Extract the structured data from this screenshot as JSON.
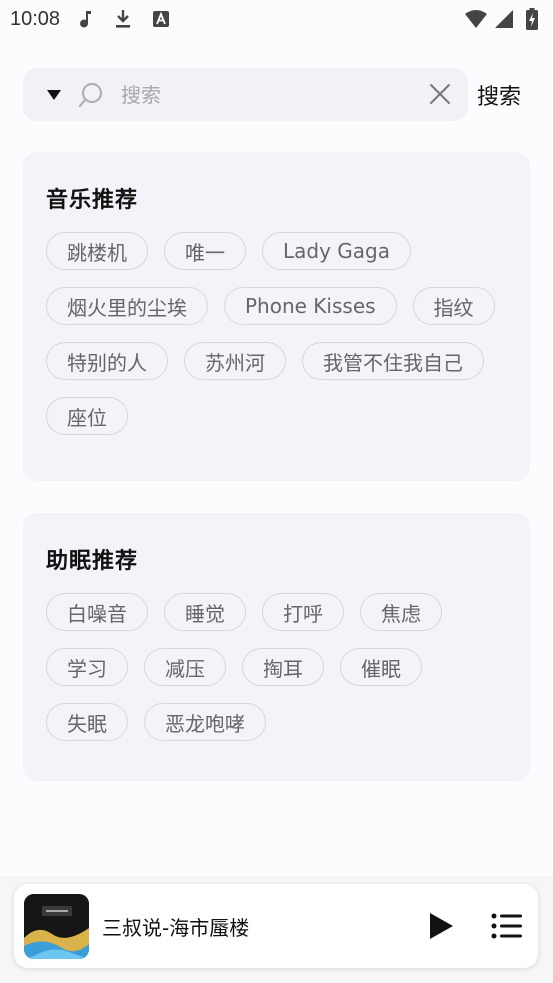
{
  "status_bar": {
    "time": "10:08",
    "left_icons": [
      "music-note-icon",
      "download-icon",
      "font-a-icon"
    ],
    "right_icons": [
      "wifi-icon",
      "signal-icon",
      "battery-charging-icon"
    ]
  },
  "search": {
    "placeholder": "搜索",
    "value": "",
    "button_label": "搜索"
  },
  "music_recommend": {
    "title": "音乐推荐",
    "tags": [
      "跳楼机",
      "唯一",
      "Lady Gaga",
      "烟火里的尘埃",
      "Phone Kisses",
      "指纹",
      "特别的人",
      "苏州河",
      "我管不住我自己",
      "座位"
    ]
  },
  "sleep_recommend": {
    "title": "助眠推荐",
    "tags": [
      "白噪音",
      "睡觉",
      "打呼",
      "焦虑",
      "学习",
      "减压",
      "掏耳",
      "催眠",
      "失眠",
      "恶龙咆哮"
    ]
  },
  "player": {
    "now_playing": "三叔说-海市蜃楼",
    "album_icon": "album-cover",
    "play_icon": "play-icon",
    "playlist_icon": "playlist-icon"
  },
  "colors": {
    "card_background": "#f3f4f9",
    "tag_border": "#d6d7dc",
    "tag_text": "#666666",
    "search_background": "#f1f2f6"
  }
}
